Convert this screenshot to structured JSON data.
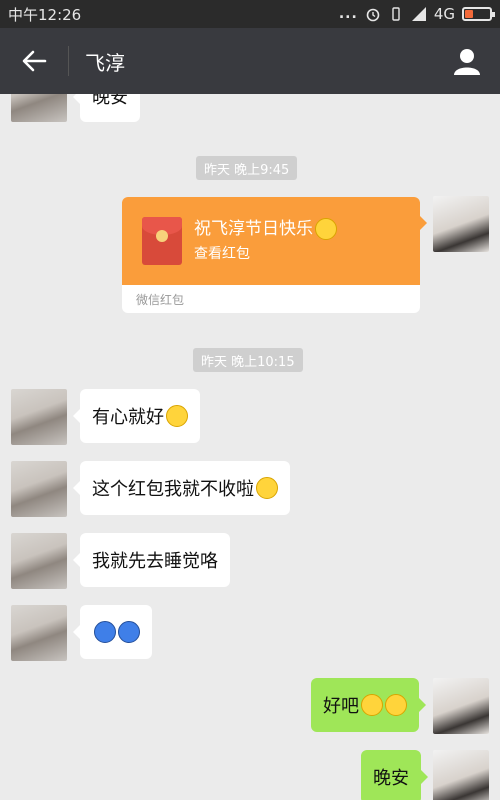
{
  "status_bar": {
    "time": "中午12:26",
    "dots": "...",
    "network": "4G",
    "battery_level": 0.35
  },
  "header": {
    "back_icon": "back-arrow-icon",
    "title": "飞淳",
    "profile_icon": "person-icon"
  },
  "messages": {
    "top_partial": {
      "side": "left",
      "text": "晚安"
    },
    "timestamp_1": "昨天 晚上9:45",
    "red_packet": {
      "side": "right",
      "title": "祝飞淳节日快乐",
      "subtitle": "查看红包",
      "footer": "微信红包"
    },
    "timestamp_2": "昨天 晚上10:15",
    "msg_1": "有心就好",
    "msg_2": "这个红包我就不收啦",
    "msg_3": "我就先去睡觉咯",
    "msg_5": "好吧",
    "msg_6": "晚安"
  },
  "colors": {
    "header_bg": "#393a3f",
    "chat_bg": "#ebebeb",
    "sent_bubble": "#9fe658",
    "red_packet": "#fa9d3b"
  }
}
